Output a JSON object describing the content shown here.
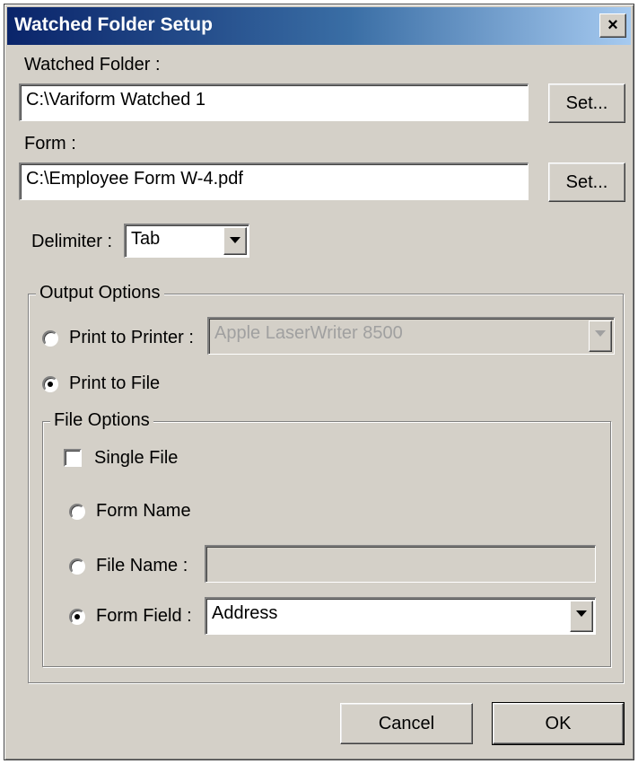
{
  "window": {
    "title": "Watched Folder Setup",
    "close_glyph": "×"
  },
  "watched_folder": {
    "label": "Watched Folder :",
    "value": "C:\\Variform Watched 1",
    "set_label": "Set..."
  },
  "form": {
    "label": "Form :",
    "value": "C:\\Employee Form W-4.pdf",
    "set_label": "Set..."
  },
  "delimiter": {
    "label": "Delimiter :",
    "selected": "Tab"
  },
  "output_options": {
    "title": "Output Options",
    "print_to_printer": {
      "label": "Print to Printer :",
      "selected": false,
      "printer": "Apple LaserWriter 8500",
      "enabled": false
    },
    "print_to_file": {
      "label": "Print to File",
      "selected": true
    }
  },
  "file_options": {
    "title": "File Options",
    "single_file": {
      "label": "Single File",
      "checked": false
    },
    "form_name": {
      "label": "Form Name",
      "selected": false
    },
    "file_name": {
      "label": "File Name :",
      "selected": false,
      "value": ""
    },
    "form_field": {
      "label": "Form Field :",
      "selected": true,
      "value": "Address"
    }
  },
  "buttons": {
    "cancel": "Cancel",
    "ok": "OK"
  }
}
